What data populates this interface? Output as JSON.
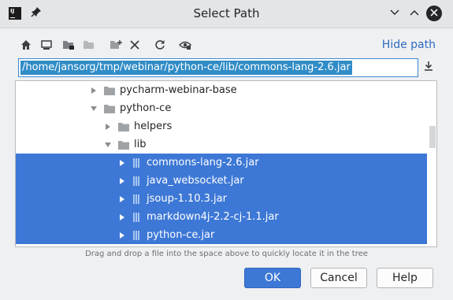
{
  "window": {
    "title": "Select Path",
    "controls": {
      "minimize": "⌄",
      "maximize": "⌃",
      "close": "✕"
    },
    "logo": "IJ"
  },
  "toolbar": {
    "buttons": [
      {
        "icon": "home-icon"
      },
      {
        "icon": "desktop-icon"
      },
      {
        "icon": "project-folder-icon"
      },
      {
        "icon": "module-folder-icon"
      },
      {
        "icon": "new-folder-icon"
      },
      {
        "icon": "delete-icon"
      },
      {
        "icon": "refresh-icon"
      },
      {
        "icon": "show-hidden-icon"
      }
    ],
    "hide_path_label": "Hide path"
  },
  "path_field": {
    "value": "/home/jansorg/tmp/webinar/python-ce/lib/commons-lang-2.6.jar"
  },
  "tree": {
    "rows": [
      {
        "label": "pycharm-webinar-base",
        "kind": "folder",
        "depth": 0,
        "expanded": false,
        "selected": false
      },
      {
        "label": "python-ce",
        "kind": "folder",
        "depth": 0,
        "expanded": true,
        "selected": false
      },
      {
        "label": "helpers",
        "kind": "folder",
        "depth": 1,
        "expanded": false,
        "selected": false
      },
      {
        "label": "lib",
        "kind": "folder",
        "depth": 1,
        "expanded": true,
        "selected": false
      },
      {
        "label": "commons-lang-2.6.jar",
        "kind": "jar",
        "depth": 2,
        "expanded": false,
        "selected": true
      },
      {
        "label": "java_websocket.jar",
        "kind": "jar",
        "depth": 2,
        "expanded": false,
        "selected": true
      },
      {
        "label": "jsoup-1.10.3.jar",
        "kind": "jar",
        "depth": 2,
        "expanded": false,
        "selected": true
      },
      {
        "label": "markdown4j-2.2-cj-1.1.jar",
        "kind": "jar",
        "depth": 2,
        "expanded": false,
        "selected": true
      },
      {
        "label": "python-ce.jar",
        "kind": "jar",
        "depth": 2,
        "expanded": false,
        "selected": true
      }
    ]
  },
  "hint": "Drag and drop a file into the space above to quickly locate it in the tree",
  "buttons": {
    "ok": "OK",
    "cancel": "Cancel",
    "help": "Help"
  },
  "colors": {
    "accent": "#3d78d6",
    "path_selection": "#308cc6",
    "link": "#2f6bc0"
  }
}
